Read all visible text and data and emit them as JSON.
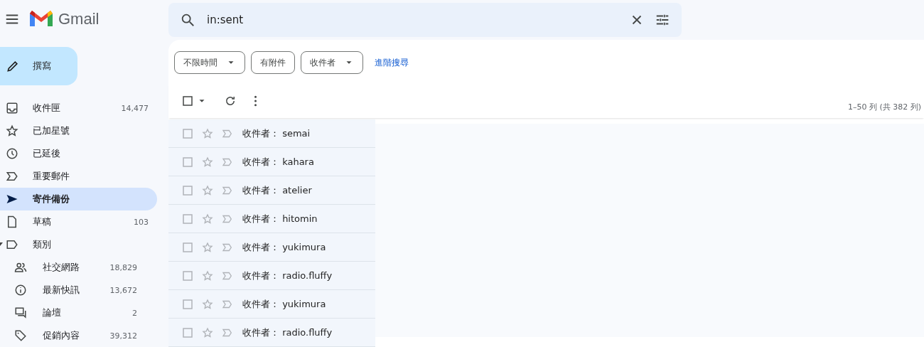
{
  "app": {
    "name": "Gmail"
  },
  "search": {
    "value": "in:sent"
  },
  "compose": {
    "label": "撰寫"
  },
  "sidebar": {
    "items": [
      {
        "kind": "inbox",
        "label": "收件匣",
        "count": "14,477",
        "selected": false
      },
      {
        "kind": "star",
        "label": "已加星號",
        "selected": false
      },
      {
        "kind": "clock",
        "label": "已延後",
        "selected": false
      },
      {
        "kind": "important",
        "label": "重要郵件",
        "selected": false
      },
      {
        "kind": "send",
        "label": "寄件備份",
        "selected": true
      },
      {
        "kind": "draft",
        "label": "草稿",
        "count": "103",
        "selected": false
      },
      {
        "kind": "label",
        "label": "類別",
        "selected": false,
        "expanded": true,
        "children": [
          {
            "kind": "people",
            "label": "社交網路",
            "count": "18,829",
            "selected": false
          },
          {
            "kind": "info",
            "label": "最新快訊",
            "count": "13,672",
            "selected": false
          },
          {
            "kind": "forum",
            "label": "論壇",
            "count": "2",
            "selected": false
          },
          {
            "kind": "tag",
            "label": "促銷內容",
            "count": "39,312",
            "selected": false
          }
        ]
      }
    ]
  },
  "filters": [
    {
      "label": "不限時間",
      "dropdown": true
    },
    {
      "label": "有附件",
      "dropdown": false
    },
    {
      "label": "收件者",
      "dropdown": true
    }
  ],
  "advanced_search": "進階搜尋",
  "select_all": {
    "checked": false
  },
  "pagination": "1–50 列 (共 382 列)",
  "messages": [
    {
      "sender": "收件者： semai",
      "checked": false,
      "starred": false
    },
    {
      "sender": "收件者： kahara",
      "checked": false,
      "starred": false
    },
    {
      "sender": "收件者： atelier",
      "checked": false,
      "starred": false
    },
    {
      "sender": "收件者： hitomin",
      "checked": false,
      "starred": false
    },
    {
      "sender": "收件者： yukimura",
      "checked": false,
      "starred": false
    },
    {
      "sender": "收件者： radio.fluffy",
      "checked": false,
      "starred": false
    },
    {
      "sender": "收件者： yukimura",
      "checked": false,
      "starred": false
    },
    {
      "sender": "收件者： radio.fluffy",
      "checked": false,
      "starred": false
    }
  ]
}
